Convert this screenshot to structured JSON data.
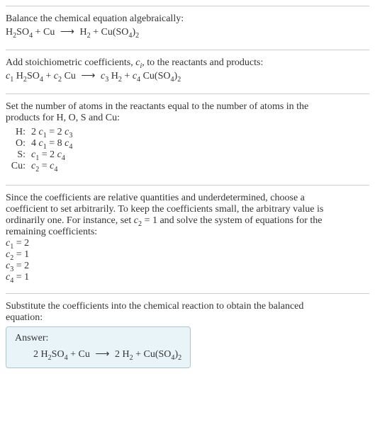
{
  "s1": {
    "intro": "Balance the chemical equation algebraically:",
    "eq_h2so4": "H",
    "eq_2a": "2",
    "eq_so": "SO",
    "eq_4a": "4",
    "plus1": " + Cu ",
    "arrow": "⟶",
    "sp": " H",
    "eq_2b": "2",
    "plus2": " + Cu(SO",
    "eq_4b": "4",
    "close": ")",
    "eq_2c": "2"
  },
  "s2": {
    "line1a": "Add stoichiometric coefficients, ",
    "ci_c": "c",
    "ci_i": "i",
    "line1b": ", to the reactants and products:",
    "c1": "c",
    "n1": "1",
    "sp1": " H",
    "h2": "2",
    "so": "SO",
    "so4": "4",
    "plus1": " + ",
    "c2": "c",
    "n2": "2",
    "cu": " Cu ",
    "arrow": "⟶",
    "sp2": " ",
    "c3": "c",
    "n3": "3",
    "h2b": " H",
    "h2s": "2",
    "plus2": " + ",
    "c4": "c",
    "n4": "4",
    "cuso": " Cu(SO",
    "so4b": "4",
    "close": ")",
    "two": "2"
  },
  "s3": {
    "intro1": "Set the number of atoms in the reactants equal to the number of atoms in the",
    "intro2": "products for H, O, S and Cu:",
    "H_label": "H:",
    "H_eq_a": "2 ",
    "H_c1": "c",
    "H_1": "1",
    "H_eq_b": " = 2 ",
    "H_c3": "c",
    "H_3": "3",
    "O_label": "O:",
    "O_eq_a": "4 ",
    "O_c1": "c",
    "O_1": "1",
    "O_eq_b": " = 8 ",
    "O_c4": "c",
    "O_4": "4",
    "S_label": "S:",
    "S_c1": "c",
    "S_1": "1",
    "S_eq_b": " = 2 ",
    "S_c4": "c",
    "S_4": "4",
    "Cu_label": "Cu:",
    "Cu_c2": "c",
    "Cu_2": "2",
    "Cu_eq_b": " = ",
    "Cu_c4": "c",
    "Cu_4": "4"
  },
  "s4": {
    "l1": "Since the coefficients are relative quantities and underdetermined, choose a",
    "l2": "coefficient to set arbitrarily. To keep the coefficients small, the arbitrary value is",
    "l3a": "ordinarily one. For instance, set ",
    "l3_c": "c",
    "l3_2": "2",
    "l3b": " = 1 and solve the system of equations for the",
    "l4": "remaining coefficients:",
    "r1_c": "c",
    "r1_n": "1",
    "r1_v": " = 2",
    "r2_c": "c",
    "r2_n": "2",
    "r2_v": " = 1",
    "r3_c": "c",
    "r3_n": "3",
    "r3_v": " = 2",
    "r4_c": "c",
    "r4_n": "4",
    "r4_v": " = 1"
  },
  "s5": {
    "l1": "Substitute the coefficients into the chemical reaction to obtain the balanced",
    "l2": "equation:",
    "answer_label": "Answer:",
    "a1": "2 H",
    "a_2a": "2",
    "a_so": "SO",
    "a_4a": "4",
    "a_plus1": " + Cu ",
    "a_arrow": "⟶",
    "a_sp": " 2 H",
    "a_2b": "2",
    "a_plus2": " + Cu(SO",
    "a_4b": "4",
    "a_close": ")",
    "a_2c": "2"
  }
}
